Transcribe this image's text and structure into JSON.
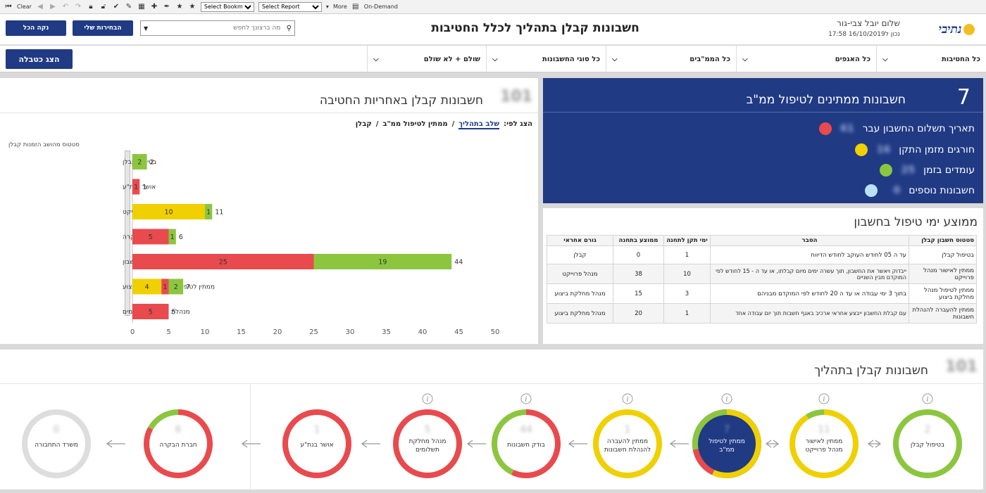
{
  "toolbar": {
    "clear": "Clear",
    "bookmark": "Select Bookmark",
    "report": "Select Report",
    "more": "More",
    "on_demand": "On-Demand"
  },
  "header": {
    "title": "חשבונות קבלן בתהליך לכלל החטיבות",
    "user": "שלום יובל צבי-גור",
    "datetime": "נכון ל16/10/2019 17:58",
    "clear_all": "נקה הכל",
    "my_selections": "הבחירות שלי",
    "search_placeholder": "מה ברצונך לחפש",
    "logo": "נתיבי"
  },
  "filters": [
    "כל החטיבות",
    "כל האגפים",
    "כל הממ\"בים",
    "כל סוגי החשבונות",
    "שולם + לא שולם"
  ],
  "show_table": "הצג כטבלה",
  "chart_panel": {
    "title": "חשבונות קבלן באחריות החטיבה",
    "blur_num": "101",
    "show_by": "הצג לפי:",
    "opt1": "שלב בתהליך",
    "opt2": "ממתין לטיפול ממ\"ב",
    "opt3": "קבלן",
    "sep": "/",
    "subtitle": "סטטוס מהושב הזמנות קבלן"
  },
  "chart_data": {
    "type": "bar",
    "categories": [
      "בטיפול קבלן",
      "אושר בנת\"ע",
      "ממתין לאישור מנהל פרוייקט",
      "חברת בקרה",
      "בודקי חשבון",
      "ממתין לטיפול מנהל מחלקת ביצוע",
      "מנהלת מחלקת תשלומים"
    ],
    "series": [
      {
        "color": "#f0d000",
        "values": [
          0,
          0,
          10,
          0,
          0,
          4,
          0
        ]
      },
      {
        "color": "#e84a4e",
        "values": [
          0,
          1,
          0,
          5,
          25,
          1,
          5
        ]
      },
      {
        "color": "#8cc63f",
        "values": [
          2,
          0,
          1,
          1,
          19,
          2,
          0
        ]
      }
    ],
    "totals": [
      2,
      1,
      11,
      6,
      44,
      7,
      5
    ],
    "xticks": [
      0,
      5,
      10,
      15,
      20,
      25,
      30,
      35,
      40,
      45,
      50
    ],
    "xlim": [
      0,
      50
    ]
  },
  "stats_panel": {
    "count": "7",
    "title": "חשבונות ממתינים לטיפול ממ\"ב",
    "rows": [
      {
        "label": "תאריך תשלום החשבון עבר",
        "value": "61",
        "color": "#e84a4e"
      },
      {
        "label": "חורגים מזמן התקן",
        "value": "16",
        "color": "#f0d000"
      },
      {
        "label": "עומדים בזמן",
        "value": "25",
        "color": "#8cc63f"
      },
      {
        "label": "חשבונות נוספים",
        "value": "0",
        "color": "#b9e3f4"
      }
    ]
  },
  "avg_panel": {
    "title": "ממוצע ימי טיפול בחשבון",
    "headers": [
      "סטטוס חשבון קבלן",
      "הסבר",
      "ימי תקן לתחנה",
      "ממוצע בתחנה",
      "גורם אחראי"
    ],
    "rows": [
      [
        "בטיפול קבלן",
        "עד ה 05 לחודש העוקב לחודש הדיווח",
        "1",
        "0",
        "קבלן"
      ],
      [
        "ממתין לאישור מנהל פרוייקט",
        "ייבדוק ויאשר את החשבון, תוך עשרה ימים מיום קבלתו, או עד ה - 15 לחודש לפי המוקדם מבין השניים",
        "10",
        "38",
        "מנהל פרוייקט"
      ],
      [
        "ממתין לטיפול מנהל מחלקת ביצוע",
        "בתוך 3 ימי עבודה או עד ה 20 לחודש לפי המוקדם מבניהם",
        "3",
        "15",
        "מנהל מחלקת ביצוע"
      ],
      [
        "ממתין להעברה להנהלת חשבונות",
        "עם קבלת החשבון ייבצע אחראי ארכיב באגף חשבות תוך יום עבודה אחד",
        "1",
        "20",
        "מנהל מחלקת ביצוע"
      ]
    ]
  },
  "process_panel": {
    "title": "חשבונות קבלן בתהליך",
    "blur_num": "101",
    "steps": [
      {
        "label": "בטיפול קבלן",
        "value": "2",
        "ring": [
          {
            "c": "#8cc63f",
            "f": 1
          }
        ],
        "fill": "#fff",
        "info": true
      },
      {
        "label": "ממתין לאישור מנהל פרוייקט",
        "value": "11",
        "ring": [
          {
            "c": "#f0d000",
            "f": 0.91
          },
          {
            "c": "#8cc63f",
            "f": 0.09
          }
        ],
        "fill": "#fff",
        "info": true
      },
      {
        "label": "ממתין לטיפול ממ\"ב",
        "value": "7",
        "ring": [
          {
            "c": "#f0d000",
            "f": 0.57
          },
          {
            "c": "#e84a4e",
            "f": 0.15
          },
          {
            "c": "#8cc63f",
            "f": 0.28
          }
        ],
        "fill": "#203a84",
        "info": true
      },
      {
        "label": "ממתין להעברה להנהלת חשבונות",
        "value": "1",
        "ring": [
          {
            "c": "#f0d000",
            "f": 1
          }
        ],
        "fill": "#fff",
        "info": true
      },
      {
        "label": "בודק חשבונות",
        "value": "44",
        "ring": [
          {
            "c": "#e84a4e",
            "f": 0.57
          },
          {
            "c": "#8cc63f",
            "f": 0.43
          }
        ],
        "fill": "#fff",
        "info": true
      },
      {
        "label": "מנהל מחלקת תשלומים",
        "value": "5",
        "ring": [
          {
            "c": "#e84a4e",
            "f": 1
          }
        ],
        "fill": "#fff",
        "info": true
      },
      {
        "label": "אושר בנת\"ע",
        "value": "1",
        "ring": [
          {
            "c": "#e84a4e",
            "f": 1
          }
        ],
        "fill": "#fff",
        "info": false
      },
      {
        "label": "חברת הבקרה",
        "value": "6",
        "ring": [
          {
            "c": "#e84a4e",
            "f": 0.83
          },
          {
            "c": "#8cc63f",
            "f": 0.17
          }
        ],
        "fill": "#fff",
        "info": false
      },
      {
        "label": "משרד התחבורה",
        "value": "0",
        "ring": [
          {
            "c": "#dddddd",
            "f": 1
          }
        ],
        "fill": "#fff",
        "info": false
      }
    ]
  }
}
